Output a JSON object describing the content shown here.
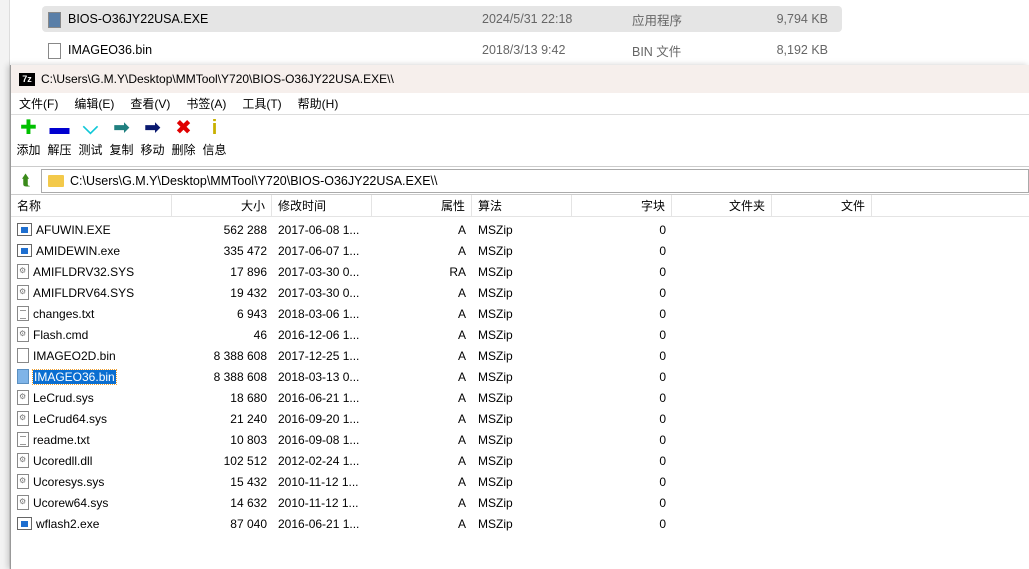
{
  "background_explorer": {
    "rows": [
      {
        "name": "BIOS-O36JY22USA.EXE",
        "date": "2024/5/31 22:18",
        "type": "应用程序",
        "size": "9,794 KB",
        "selected": true
      },
      {
        "name": "IMAGEO36.bin",
        "date": "2018/3/13 9:42",
        "type": "BIN 文件",
        "size": "8,192 KB",
        "selected": false
      }
    ]
  },
  "window": {
    "title": "C:\\Users\\G.M.Y\\Desktop\\MMTool\\Y720\\BIOS-O36JY22USA.EXE\\\\",
    "logo": "7z"
  },
  "menu": [
    "文件(F)",
    "编辑(E)",
    "查看(V)",
    "书签(A)",
    "工具(T)",
    "帮助(H)"
  ],
  "toolbar": [
    {
      "label": "添加",
      "icon": "plus-icon",
      "glyph": "✚",
      "color": "#00c000"
    },
    {
      "label": "解压",
      "icon": "minus-icon",
      "glyph": "▬",
      "color": "#0000d0"
    },
    {
      "label": "测试",
      "icon": "check-icon",
      "glyph": "⌵",
      "color": "#10c8d8"
    },
    {
      "label": "复制",
      "icon": "copy-arrow-icon",
      "glyph": "➡",
      "color": "#208080"
    },
    {
      "label": "移动",
      "icon": "move-arrow-icon",
      "glyph": "➡",
      "color": "#0a1a70"
    },
    {
      "label": "删除",
      "icon": "delete-icon",
      "glyph": "✖",
      "color": "#e00000"
    },
    {
      "label": "信息",
      "icon": "info-icon",
      "glyph": "i",
      "color": "#c8b000"
    }
  ],
  "address": "C:\\Users\\G.M.Y\\Desktop\\MMTool\\Y720\\BIOS-O36JY22USA.EXE\\\\",
  "columns": [
    "名称",
    "大小",
    "修改时间",
    "属性",
    "算法",
    "字块",
    "文件夹",
    "文件"
  ],
  "files": [
    {
      "name": "AFUWIN.EXE",
      "size": "562 288",
      "modified": "2017-06-08 1...",
      "attr": "A",
      "method": "MSZip",
      "block": "0",
      "type": "exe"
    },
    {
      "name": "AMIDEWIN.exe",
      "size": "335 472",
      "modified": "2017-06-07 1...",
      "attr": "A",
      "method": "MSZip",
      "block": "0",
      "type": "exe"
    },
    {
      "name": "AMIFLDRV32.SYS",
      "size": "17 896",
      "modified": "2017-03-30 0...",
      "attr": "RA",
      "method": "MSZip",
      "block": "0",
      "type": "sys"
    },
    {
      "name": "AMIFLDRV64.SYS",
      "size": "19 432",
      "modified": "2017-03-30 0...",
      "attr": "A",
      "method": "MSZip",
      "block": "0",
      "type": "sys"
    },
    {
      "name": "changes.txt",
      "size": "6 943",
      "modified": "2018-03-06 1...",
      "attr": "A",
      "method": "MSZip",
      "block": "0",
      "type": "txt"
    },
    {
      "name": "Flash.cmd",
      "size": "46",
      "modified": "2016-12-06 1...",
      "attr": "A",
      "method": "MSZip",
      "block": "0",
      "type": "sys"
    },
    {
      "name": "IMAGEO2D.bin",
      "size": "8 388 608",
      "modified": "2017-12-25 1...",
      "attr": "A",
      "method": "MSZip",
      "block": "0",
      "type": "bin"
    },
    {
      "name": "IMAGEO36.bin",
      "size": "8 388 608",
      "modified": "2018-03-13 0...",
      "attr": "A",
      "method": "MSZip",
      "block": "0",
      "type": "bin",
      "selected": true
    },
    {
      "name": "LeCrud.sys",
      "size": "18 680",
      "modified": "2016-06-21 1...",
      "attr": "A",
      "method": "MSZip",
      "block": "0",
      "type": "sys"
    },
    {
      "name": "LeCrud64.sys",
      "size": "21 240",
      "modified": "2016-09-20 1...",
      "attr": "A",
      "method": "MSZip",
      "block": "0",
      "type": "sys"
    },
    {
      "name": "readme.txt",
      "size": "10 803",
      "modified": "2016-09-08 1...",
      "attr": "A",
      "method": "MSZip",
      "block": "0",
      "type": "txt"
    },
    {
      "name": "Ucoredll.dll",
      "size": "102 512",
      "modified": "2012-02-24 1...",
      "attr": "A",
      "method": "MSZip",
      "block": "0",
      "type": "sys"
    },
    {
      "name": "Ucoresys.sys",
      "size": "15 432",
      "modified": "2010-11-12 1...",
      "attr": "A",
      "method": "MSZip",
      "block": "0",
      "type": "sys"
    },
    {
      "name": "Ucorew64.sys",
      "size": "14 632",
      "modified": "2010-11-12 1...",
      "attr": "A",
      "method": "MSZip",
      "block": "0",
      "type": "sys"
    },
    {
      "name": "wflash2.exe",
      "size": "87 040",
      "modified": "2016-06-21 1...",
      "attr": "A",
      "method": "MSZip",
      "block": "0",
      "type": "exe"
    }
  ]
}
